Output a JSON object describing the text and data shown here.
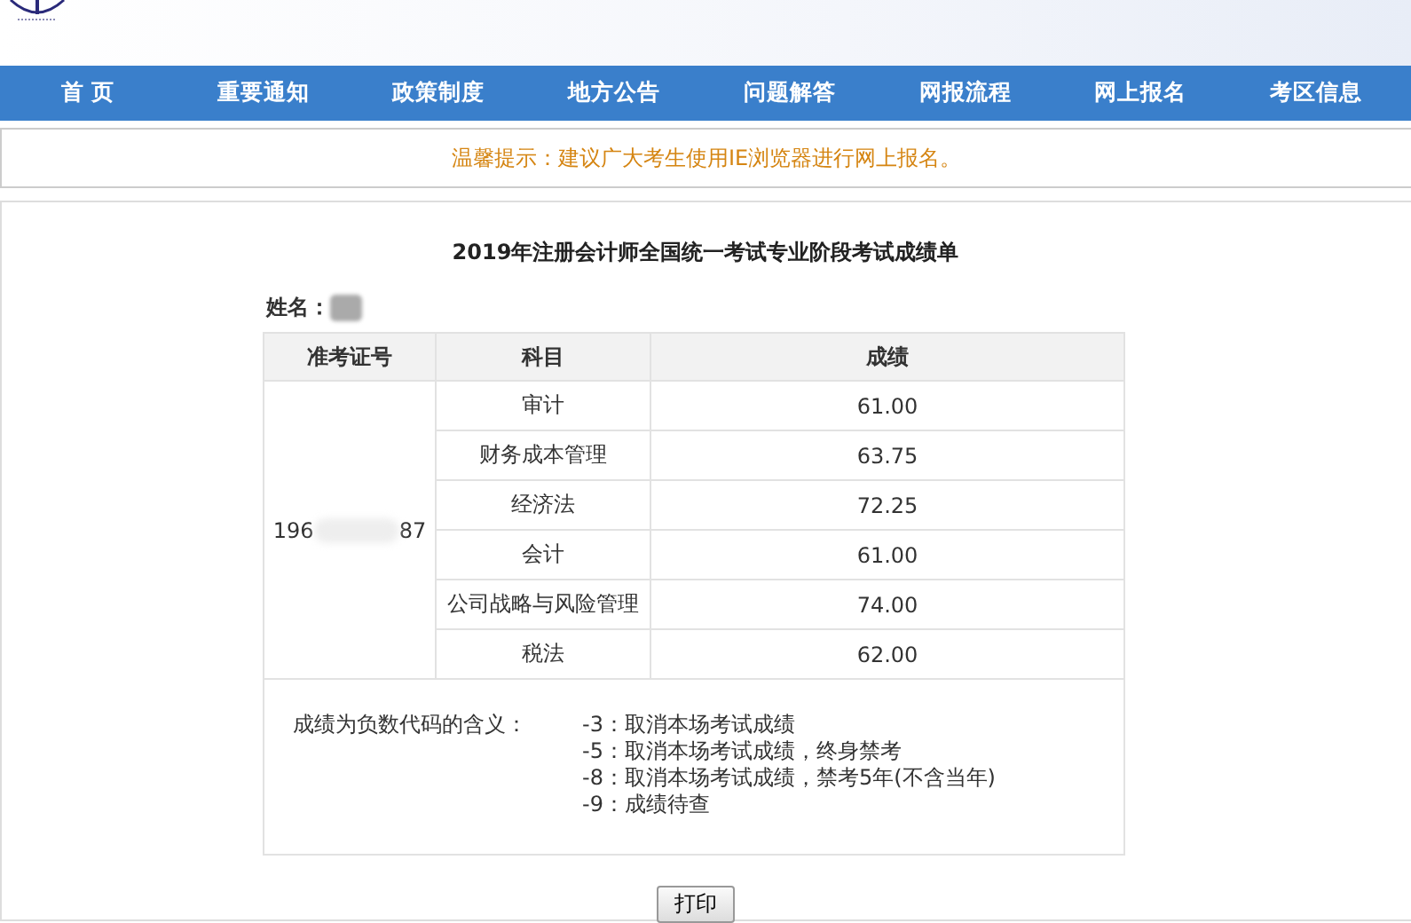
{
  "nav": [
    {
      "label": "首 页"
    },
    {
      "label": "重要通知"
    },
    {
      "label": "政策制度"
    },
    {
      "label": "地方公告"
    },
    {
      "label": "问题解答"
    },
    {
      "label": "网报流程"
    },
    {
      "label": "网上报名"
    },
    {
      "label": "考区信息"
    }
  ],
  "notice": "温馨提示：建议广大考生使用IE浏览器进行网上报名。",
  "report": {
    "title": "2019年注册会计师全国统一考试专业阶段考试成绩单",
    "name_label": "姓名：",
    "columns": [
      "准考证号",
      "科目",
      "成绩"
    ],
    "id_prefix": "196",
    "id_suffix": "87",
    "rows": [
      {
        "subject": "审计",
        "score": "61.00"
      },
      {
        "subject": "财务成本管理",
        "score": "63.75"
      },
      {
        "subject": "经济法",
        "score": "72.25"
      },
      {
        "subject": "会计",
        "score": "61.00"
      },
      {
        "subject": "公司战略与风险管理",
        "score": "74.00"
      },
      {
        "subject": "税法",
        "score": "62.00"
      }
    ],
    "codes_label": "成绩为负数代码的含义：",
    "codes": [
      "-3：取消本场考试成绩",
      "-5：取消本场考试成绩，终身禁考",
      "-8：取消本场考试成绩，禁考5年(不含当年)",
      "-9：成绩待查"
    ]
  },
  "print_button": "打印"
}
